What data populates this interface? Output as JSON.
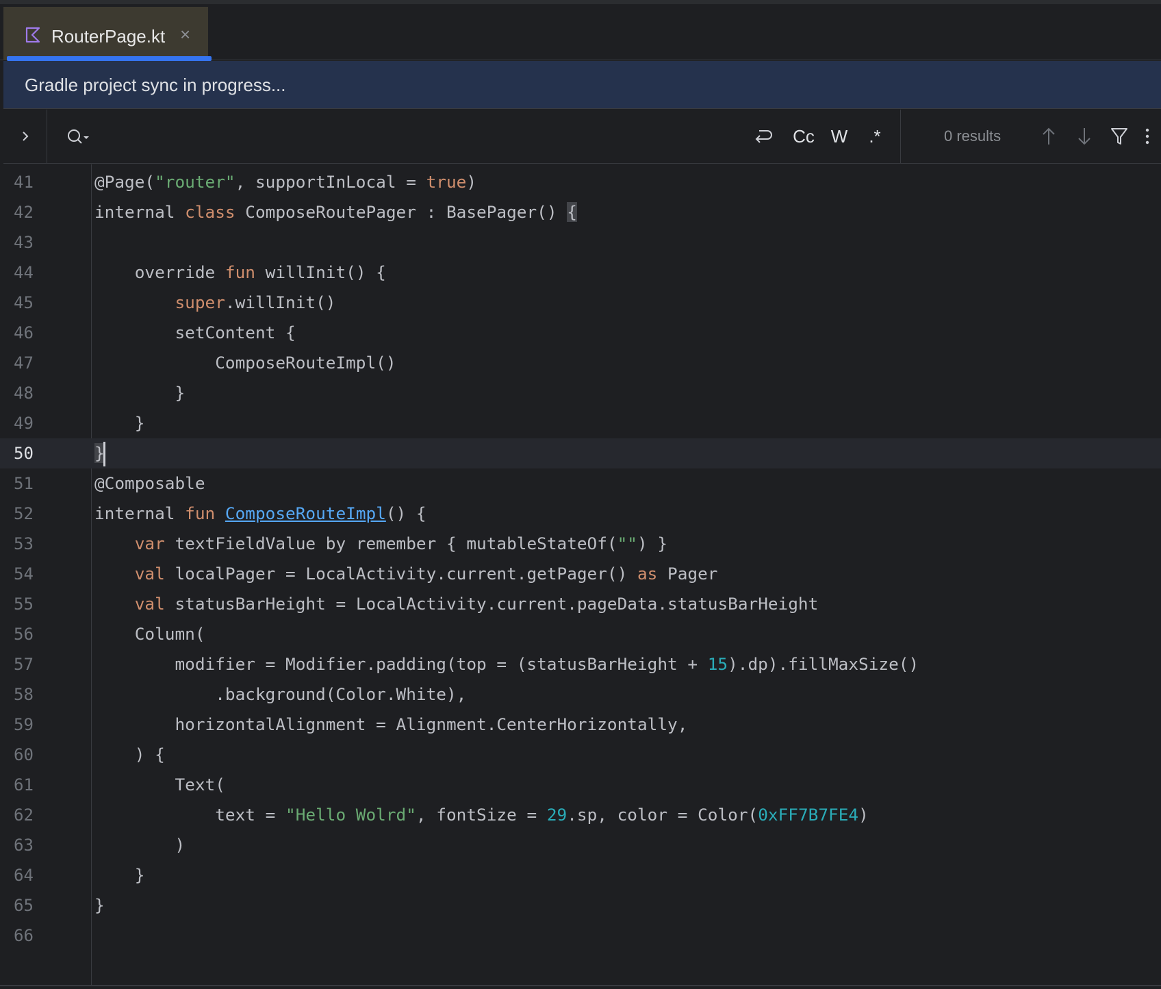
{
  "tab": {
    "file_name": "RouterPage.kt",
    "close_glyph": "×"
  },
  "banner": {
    "text": "Gradle project sync in progress..."
  },
  "search": {
    "placeholder": "",
    "value": "",
    "match_case_label": "Cc",
    "words_label": "W",
    "regex_label": ".*",
    "results_text": "0 results"
  },
  "icons": {
    "tab_file": "kotlin-file-icon",
    "expand": "chevron-right-icon",
    "search": "search-history-icon",
    "newline": "newline-icon",
    "prev": "arrow-up-icon",
    "next": "arrow-down-icon",
    "filter": "filter-icon",
    "more": "more-vertical-icon"
  },
  "colors": {
    "accent": "#3574f0",
    "keyword": "#cf8e6d",
    "string": "#6aab73",
    "number": "#2aacb8",
    "link": "#56a8f5",
    "kotlin_icon": "#9f7aea"
  },
  "editor": {
    "current_line": 50,
    "lines": [
      {
        "n": 41,
        "text": "@Page(\"router\", supportInLocal = true)"
      },
      {
        "n": 42,
        "text": "internal class ComposeRoutePager : BasePager() {"
      },
      {
        "n": 43,
        "text": ""
      },
      {
        "n": 44,
        "text": "    override fun willInit() {"
      },
      {
        "n": 45,
        "text": "        super.willInit()"
      },
      {
        "n": 46,
        "text": "        setContent {"
      },
      {
        "n": 47,
        "text": "            ComposeRouteImpl()"
      },
      {
        "n": 48,
        "text": "        }"
      },
      {
        "n": 49,
        "text": "    }"
      },
      {
        "n": 50,
        "text": "}"
      },
      {
        "n": 51,
        "text": "@Composable"
      },
      {
        "n": 52,
        "text": "internal fun ComposeRouteImpl() {"
      },
      {
        "n": 53,
        "text": "    var textFieldValue by remember { mutableStateOf(\"\") }"
      },
      {
        "n": 54,
        "text": "    val localPager = LocalActivity.current.getPager() as Pager"
      },
      {
        "n": 55,
        "text": "    val statusBarHeight = LocalActivity.current.pageData.statusBarHeight"
      },
      {
        "n": 56,
        "text": "    Column("
      },
      {
        "n": 57,
        "text": "        modifier = Modifier.padding(top = (statusBarHeight + 15).dp).fillMaxSize()"
      },
      {
        "n": 58,
        "text": "            .background(Color.White),"
      },
      {
        "n": 59,
        "text": "        horizontalAlignment = Alignment.CenterHorizontally,"
      },
      {
        "n": 60,
        "text": "    ) {"
      },
      {
        "n": 61,
        "text": "        Text("
      },
      {
        "n": 62,
        "text": "            text = \"Hello Wolrd\", fontSize = 29.sp, color = Color(0xFF7B7FE4)"
      },
      {
        "n": 63,
        "text": "        )"
      },
      {
        "n": 64,
        "text": "    }"
      },
      {
        "n": 65,
        "text": "}"
      },
      {
        "n": 66,
        "text": ""
      }
    ]
  }
}
